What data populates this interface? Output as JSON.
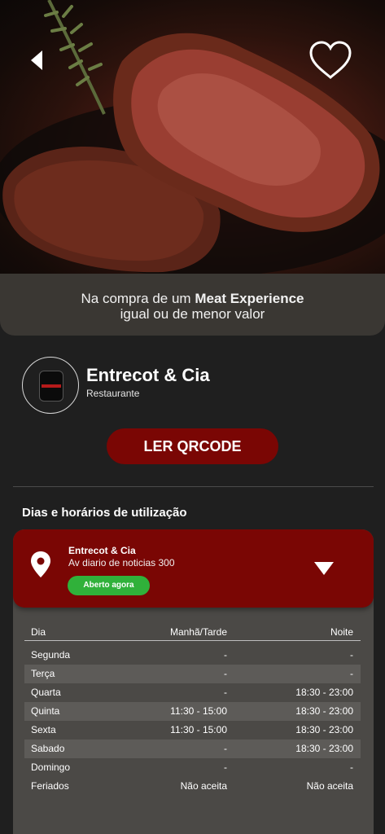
{
  "header": {
    "back_icon": "chevron-left-icon",
    "favorite_icon": "heart-outline-icon"
  },
  "promo": {
    "line1_prefix": "Na compra de  um ",
    "line1_bold": "Meat Experience",
    "line2": "igual ou de menor valor"
  },
  "restaurant": {
    "name": "Entrecot & Cia",
    "type": "Restaurante"
  },
  "actions": {
    "qr_label": "LER QRCODE"
  },
  "schedule_section": {
    "title": "Dias e horários de utilização",
    "location_name": "Entrecot & Cia",
    "location_address": "Av diario de noticias 300",
    "status": "Aberto agora",
    "table": {
      "headers": [
        "Dia",
        "Manhã/Tarde",
        "Noite"
      ],
      "rows": [
        [
          "Segunda",
          "-",
          "-"
        ],
        [
          "Terça",
          "-",
          "-"
        ],
        [
          "Quarta",
          "-",
          "18:30 - 23:00"
        ],
        [
          "Quinta",
          "11:30 - 15:00",
          "18:30 - 23:00"
        ],
        [
          "Sexta",
          "11:30 - 15:00",
          "18:30 - 23:00"
        ],
        [
          "Sabado",
          "-",
          "18:30 - 23:00"
        ],
        [
          "Domingo",
          "-",
          "-"
        ],
        [
          "Feriados",
          "Não aceita",
          "Não aceita"
        ]
      ]
    }
  },
  "colors": {
    "accent": "#7a0604",
    "status_green": "#30b13a",
    "background": "#1f1f1f",
    "card": "#4b4946"
  }
}
